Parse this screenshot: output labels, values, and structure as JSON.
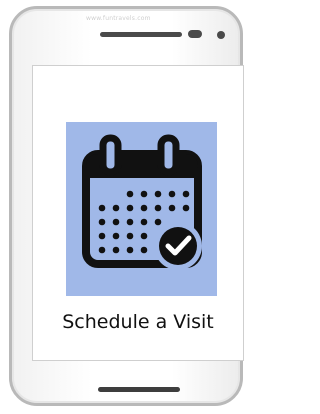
{
  "device": {
    "watermark": "www.funtravels.com"
  },
  "screen": {
    "icon": "calendar-check-icon",
    "title": "Schedule a Visit"
  },
  "colors": {
    "icon_tile_bg": "#a0b8e8",
    "icon_ink": "#111111"
  }
}
